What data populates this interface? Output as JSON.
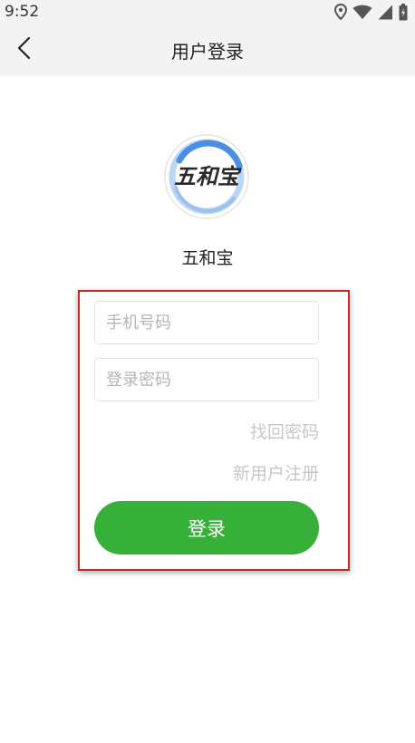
{
  "status_bar": {
    "time": "9:52",
    "icons": [
      "location-icon",
      "wifi-icon",
      "signal-icon",
      "battery-icon"
    ]
  },
  "app_bar": {
    "title": "用户登录",
    "back_icon": "chevron-left-icon"
  },
  "logo": {
    "text": "五和宝",
    "colors": {
      "ring": "#4a8fe0",
      "ring_light": "#bcd6f5",
      "text": "#2a2a2a"
    }
  },
  "app_name": "五和宝",
  "form": {
    "phone": {
      "value": "",
      "placeholder": "手机号码"
    },
    "password": {
      "value": "",
      "placeholder": "登录密码"
    },
    "forgot_password": "找回密码",
    "register": "新用户注册",
    "login_button": "登录"
  },
  "colors": {
    "accent": "#37b03a",
    "highlight": "#c62828",
    "bar_bg": "#f3f3f3"
  }
}
